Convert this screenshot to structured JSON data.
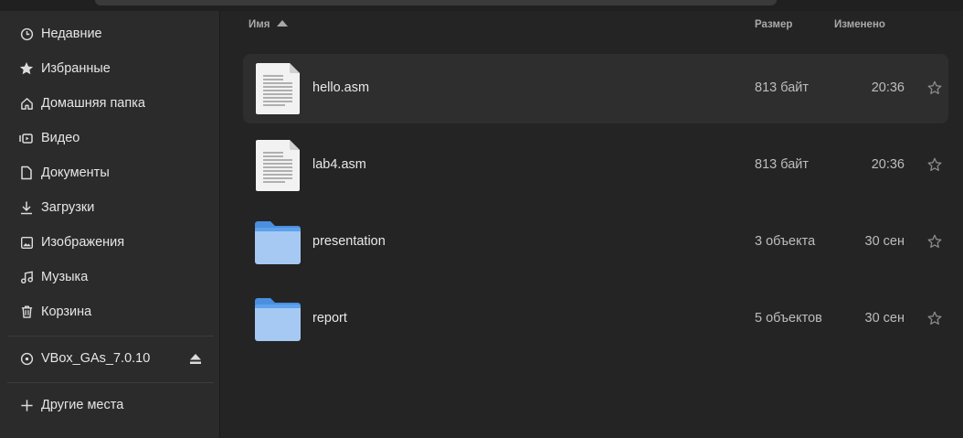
{
  "sidebar": {
    "items": [
      {
        "label": "Недавние",
        "icon": "clock-icon"
      },
      {
        "label": "Избранные",
        "icon": "star-icon"
      },
      {
        "label": "Домашняя папка",
        "icon": "home-icon"
      },
      {
        "label": "Видео",
        "icon": "video-icon"
      },
      {
        "label": "Документы",
        "icon": "document-icon"
      },
      {
        "label": "Загрузки",
        "icon": "download-icon"
      },
      {
        "label": "Изображения",
        "icon": "image-icon"
      },
      {
        "label": "Музыка",
        "icon": "music-icon"
      },
      {
        "label": "Корзина",
        "icon": "trash-icon"
      }
    ],
    "device": {
      "label": "VBox_GAs_7.0.10",
      "icon": "disc-icon",
      "action_icon": "eject-icon"
    },
    "other_locations": {
      "label": "Другие места",
      "icon": "plus-icon"
    }
  },
  "columns": {
    "name": "Имя",
    "size": "Размер",
    "modified": "Изменено",
    "sort": "ascending"
  },
  "files": [
    {
      "name": "hello.asm",
      "size": "813 байт",
      "modified": "20:36",
      "type": "text-file-icon",
      "selected": true
    },
    {
      "name": "lab4.asm",
      "size": "813 байт",
      "modified": "20:36",
      "type": "text-file-icon",
      "selected": false
    },
    {
      "name": "presentation",
      "size": "3 объекта",
      "modified": "30 сен",
      "type": "folder-icon",
      "selected": false
    },
    {
      "name": "report",
      "size": "5 объектов",
      "modified": "30 сен",
      "type": "folder-icon",
      "selected": false
    }
  ],
  "colors": {
    "folder_blue": "#5ea1ec",
    "folder_light": "#a5c9f2",
    "background": "#242424",
    "sidebar": "#2b2b2b"
  }
}
